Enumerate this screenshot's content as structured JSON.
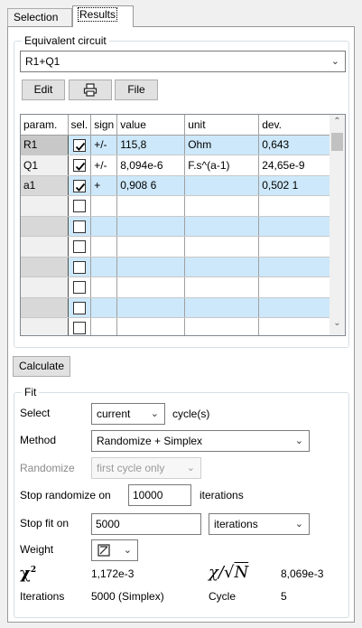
{
  "tabs": [
    {
      "label": "Selection"
    },
    {
      "label": "Results"
    }
  ],
  "circuit_group": {
    "legend": "Equivalent circuit",
    "circuit_value": "R1+Q1",
    "buttons": {
      "edit": "Edit",
      "file": "File"
    }
  },
  "grid": {
    "headers": {
      "param": "param.",
      "sel": "sel.",
      "sign": "sign",
      "value": "value",
      "unit": "unit",
      "dev": "dev."
    },
    "rows": [
      {
        "param": "R1",
        "checked": true,
        "sign": "+/-",
        "value": "115,8",
        "unit": "Ohm",
        "dev": "0,643"
      },
      {
        "param": "Q1",
        "checked": true,
        "sign": "+/-",
        "value": "8,094e-6",
        "unit": "F.s^(a-1)",
        "dev": "24,65e-9"
      },
      {
        "param": "a1",
        "checked": true,
        "sign": "+",
        "value": "0,908 6",
        "unit": "",
        "dev": "0,502 1"
      },
      {
        "param": "",
        "checked": false,
        "sign": "",
        "value": "",
        "unit": "",
        "dev": ""
      },
      {
        "param": "",
        "checked": false,
        "sign": "",
        "value": "",
        "unit": "",
        "dev": ""
      },
      {
        "param": "",
        "checked": false,
        "sign": "",
        "value": "",
        "unit": "",
        "dev": ""
      },
      {
        "param": "",
        "checked": false,
        "sign": "",
        "value": "",
        "unit": "",
        "dev": ""
      },
      {
        "param": "",
        "checked": false,
        "sign": "",
        "value": "",
        "unit": "",
        "dev": ""
      },
      {
        "param": "",
        "checked": false,
        "sign": "",
        "value": "",
        "unit": "",
        "dev": ""
      },
      {
        "param": "",
        "checked": false,
        "sign": "",
        "value": "",
        "unit": "",
        "dev": ""
      }
    ]
  },
  "calculate_label": "Calculate",
  "fit": {
    "legend": "Fit",
    "select_label": "Select",
    "select_value": "current",
    "cycles_label": "cycle(s)",
    "method_label": "Method",
    "method_value": "Randomize + Simplex",
    "randomize_label": "Randomize",
    "randomize_value": "first cycle only",
    "stop_randomize_label": "Stop randomize on",
    "stop_randomize_value": "10000",
    "iterations_label": "iterations",
    "stop_fit_label": "Stop fit on",
    "stop_fit_value": "5000",
    "stop_fit_unit": "iterations",
    "weight_label": "Weight",
    "chi2_value": "1,172e-3",
    "chi_sqrtN_value": "8,069e-3",
    "iterations_result_label": "Iterations",
    "iterations_result_value": "5000 (Simplex)",
    "cycle_label": "Cycle",
    "cycle_value": "5"
  },
  "colors": {
    "row_highlight": "#cde8fa",
    "border": "#7a7a7a"
  }
}
